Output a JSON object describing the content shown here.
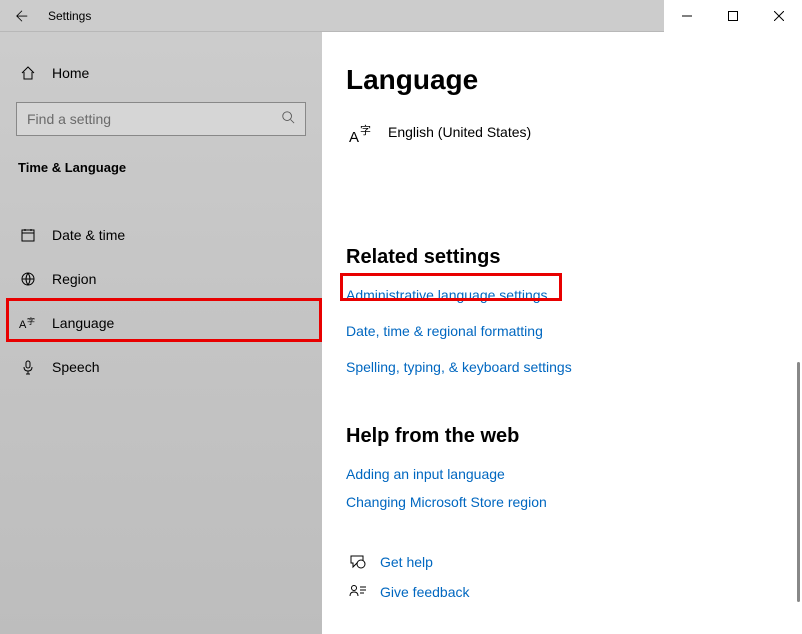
{
  "titlebar": {
    "title": "Settings"
  },
  "sidebar": {
    "home_label": "Home",
    "search_placeholder": "Find a setting",
    "category": "Time & Language",
    "items": [
      {
        "label": "Date & time",
        "icon": "calendar-icon"
      },
      {
        "label": "Region",
        "icon": "globe-icon"
      },
      {
        "label": "Language",
        "icon": "language-icon",
        "selected": true
      },
      {
        "label": "Speech",
        "icon": "microphone-icon"
      }
    ]
  },
  "main": {
    "title": "Language",
    "current_language": "English (United States)",
    "related": {
      "header": "Related settings",
      "links": [
        "Administrative language settings",
        "Date, time & regional formatting",
        "Spelling, typing, & keyboard settings"
      ]
    },
    "help": {
      "header": "Help from the web",
      "links": [
        "Adding an input language",
        "Changing Microsoft Store region"
      ]
    },
    "footer": {
      "get_help": "Get help",
      "give_feedback": "Give feedback"
    }
  },
  "annotations": {
    "highlight_sidebar_item": "Language",
    "highlight_main_link": "Administrative language settings"
  }
}
